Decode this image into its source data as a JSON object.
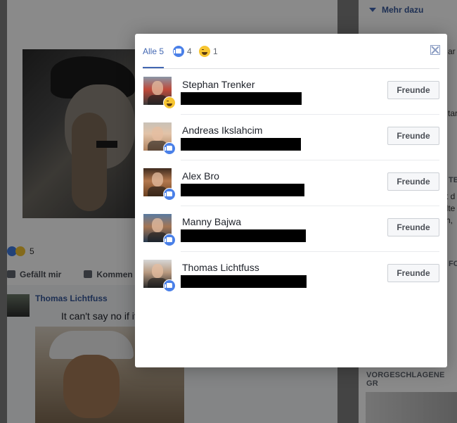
{
  "background": {
    "post_reaction_count": "5",
    "like_action": "Gefällt mir",
    "comment_action": "Kommen",
    "commenter_name": "Thomas Lichtfuss",
    "comment_text": "It can't say no if it",
    "sidebar_more": "Mehr dazu",
    "sidebar_suggested": "VORGESCHLAGENE GR",
    "sidebar_fragments": [
      "ar",
      "tar",
      "TE",
      "st d",
      "alte",
      "ch,",
      "FO"
    ]
  },
  "modal": {
    "tabs": {
      "all_label": "Alle 5",
      "like_count": "4",
      "haha_count": "1"
    },
    "close_icon": "close-icon",
    "button_label": "Freunde",
    "people": [
      {
        "name": "Stephan Trenker",
        "reaction": "haha"
      },
      {
        "name": "Andreas Ikslahcim",
        "reaction": "like"
      },
      {
        "name": "Alex Bro",
        "reaction": "like"
      },
      {
        "name": "Manny Bajwa",
        "reaction": "like"
      },
      {
        "name": "Thomas Lichtfuss",
        "reaction": "like"
      }
    ]
  },
  "colors": {
    "accent": "#4267b2",
    "like": "#4a80e8",
    "haha": "#f7c531",
    "overlay": "rgba(0,0,0,0.46)"
  }
}
